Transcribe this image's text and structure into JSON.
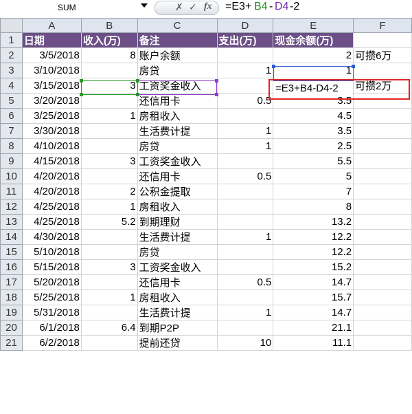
{
  "formula_bar": {
    "name_box": "SUM",
    "cancel_icon": "✗",
    "enter_icon": "✓",
    "fx_icon": "fx",
    "formula_parts": [
      {
        "text": "=E3+",
        "color": "#000000"
      },
      {
        "text": "B4",
        "color": "#1f8b1f"
      },
      {
        "text": "-",
        "color": "#000000"
      },
      {
        "text": "D4",
        "color": "#7a2fb0"
      },
      {
        "text": "-2",
        "color": "#000000"
      }
    ]
  },
  "columns": [
    "A",
    "B",
    "C",
    "D",
    "E",
    "F"
  ],
  "header_row": {
    "row": "1",
    "A": "日期",
    "B": "收入(万)",
    "C": "备注",
    "D": "支出(万)",
    "E": "现金余额(万)",
    "F": ""
  },
  "rows": [
    {
      "row": "2",
      "A": "3/5/2018",
      "B": "8",
      "C": "账户余额",
      "D": "",
      "E": "2",
      "F": "可攒6万"
    },
    {
      "row": "3",
      "A": "3/10/2018",
      "B": "",
      "C": "房贷",
      "D": "1",
      "E": "1",
      "F": ""
    },
    {
      "row": "4",
      "A": "3/15/2018",
      "B": "3",
      "C": "工资奖金收入",
      "D": "",
      "E": "=E3+B4-D4-2",
      "F": "可攒2万"
    },
    {
      "row": "5",
      "A": "3/20/2018",
      "B": "",
      "C": "还信用卡",
      "D": "0.5",
      "E": "3.5",
      "F": ""
    },
    {
      "row": "6",
      "A": "3/25/2018",
      "B": "1",
      "C": "房租收入",
      "D": "",
      "E": "4.5",
      "F": ""
    },
    {
      "row": "7",
      "A": "3/30/2018",
      "B": "",
      "C": "生活费计提",
      "D": "1",
      "E": "3.5",
      "F": ""
    },
    {
      "row": "8",
      "A": "4/10/2018",
      "B": "",
      "C": "房贷",
      "D": "1",
      "E": "2.5",
      "F": ""
    },
    {
      "row": "9",
      "A": "4/15/2018",
      "B": "3",
      "C": "工资奖金收入",
      "D": "",
      "E": "5.5",
      "F": ""
    },
    {
      "row": "10",
      "A": "4/20/2018",
      "B": "",
      "C": "还信用卡",
      "D": "0.5",
      "E": "5",
      "F": ""
    },
    {
      "row": "11",
      "A": "4/20/2018",
      "B": "2",
      "C": "公积金提取",
      "D": "",
      "E": "7",
      "F": ""
    },
    {
      "row": "12",
      "A": "4/25/2018",
      "B": "1",
      "C": "房租收入",
      "D": "",
      "E": "8",
      "F": ""
    },
    {
      "row": "13",
      "A": "4/25/2018",
      "B": "5.2",
      "C": "到期理财",
      "D": "",
      "E": "13.2",
      "F": ""
    },
    {
      "row": "14",
      "A": "4/30/2018",
      "B": "",
      "C": "生活费计提",
      "D": "1",
      "E": "12.2",
      "F": ""
    },
    {
      "row": "15",
      "A": "5/10/2018",
      "B": "",
      "C": "房贷",
      "D": "",
      "E": "12.2",
      "F": ""
    },
    {
      "row": "16",
      "A": "5/15/2018",
      "B": "3",
      "C": "工资奖金收入",
      "D": "",
      "E": "15.2",
      "F": ""
    },
    {
      "row": "17",
      "A": "5/20/2018",
      "B": "",
      "C": "还信用卡",
      "D": "0.5",
      "E": "14.7",
      "F": ""
    },
    {
      "row": "18",
      "A": "5/25/2018",
      "B": "1",
      "C": "房租收入",
      "D": "",
      "E": "15.7",
      "F": ""
    },
    {
      "row": "19",
      "A": "5/31/2018",
      "B": "",
      "C": "生活费计提",
      "D": "1",
      "E": "14.7",
      "F": ""
    },
    {
      "row": "20",
      "A": "6/1/2018",
      "B": "6.4",
      "C": "到期P2P",
      "D": "",
      "E": "21.1",
      "F": ""
    },
    {
      "row": "21",
      "A": "6/2/2018",
      "B": "",
      "C": "提前还贷",
      "D": "10",
      "E": "11.1",
      "F": ""
    }
  ],
  "colors": {
    "header_fill": "#6b4f86",
    "header_text": "#ffffff",
    "ref_b4": "#1f8b1f",
    "ref_d4": "#7a2fb0",
    "ref_e3": "#2f5fd1",
    "callout": "#e02626"
  }
}
